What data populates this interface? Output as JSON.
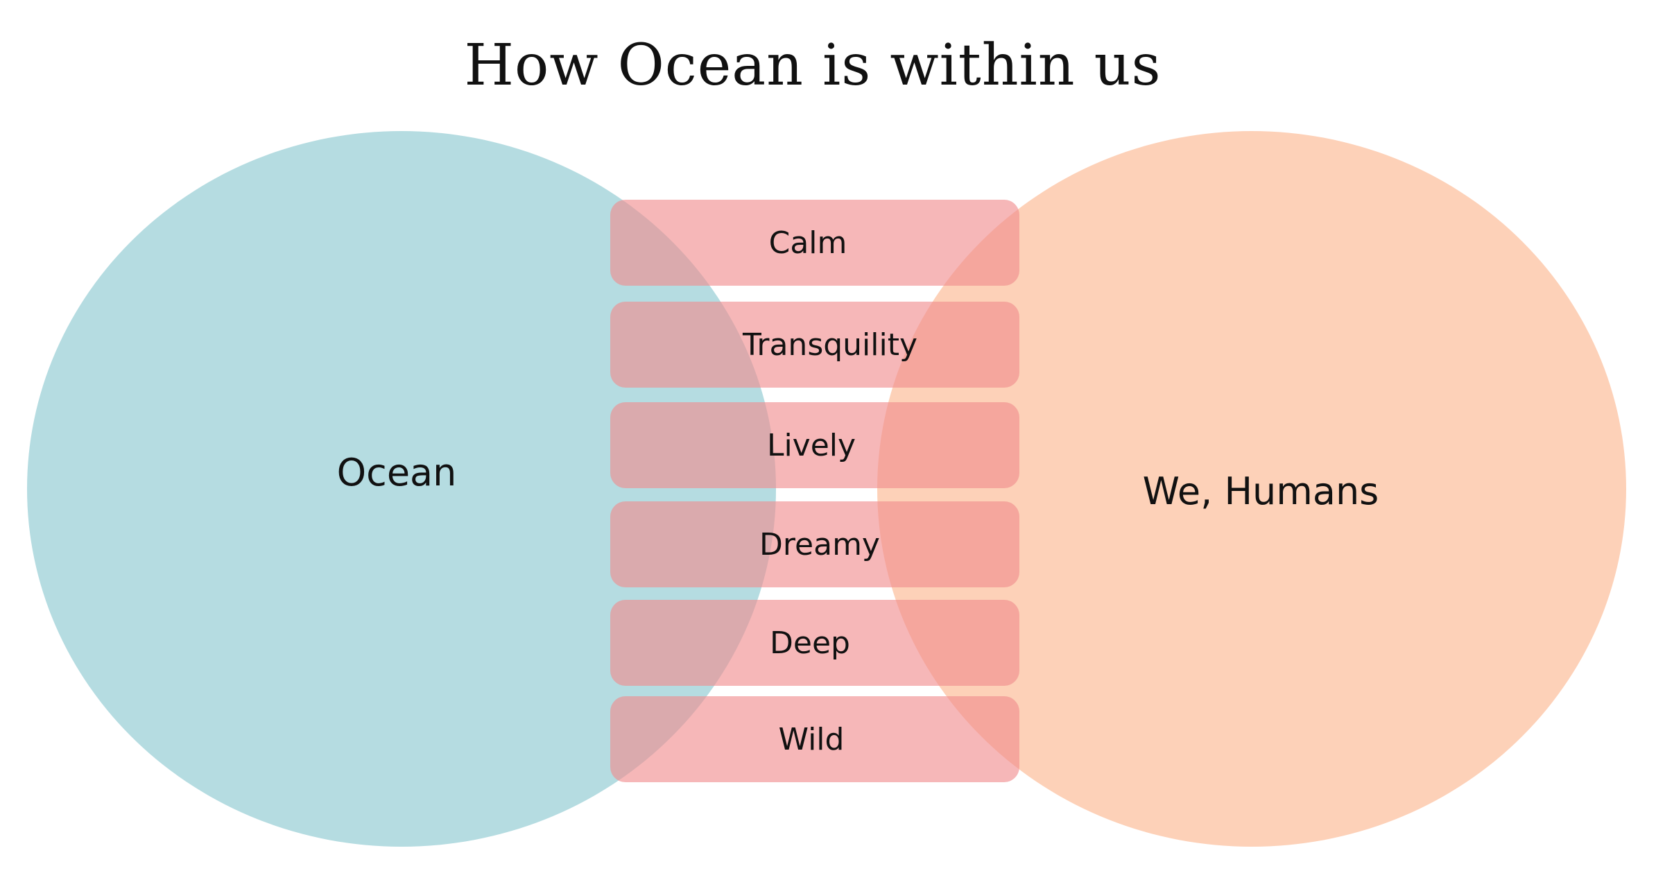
{
  "title": "How Ocean is within us",
  "left_circle": {
    "label": "Ocean",
    "color": "#b5dce1"
  },
  "right_circle": {
    "label": "We, Humans",
    "color": "#fdd1b8"
  },
  "bar_color": "#f08a8c",
  "shared_items": [
    "Calm",
    "Transquility",
    "Lively",
    "Dreamy",
    "Deep",
    "Wild"
  ]
}
